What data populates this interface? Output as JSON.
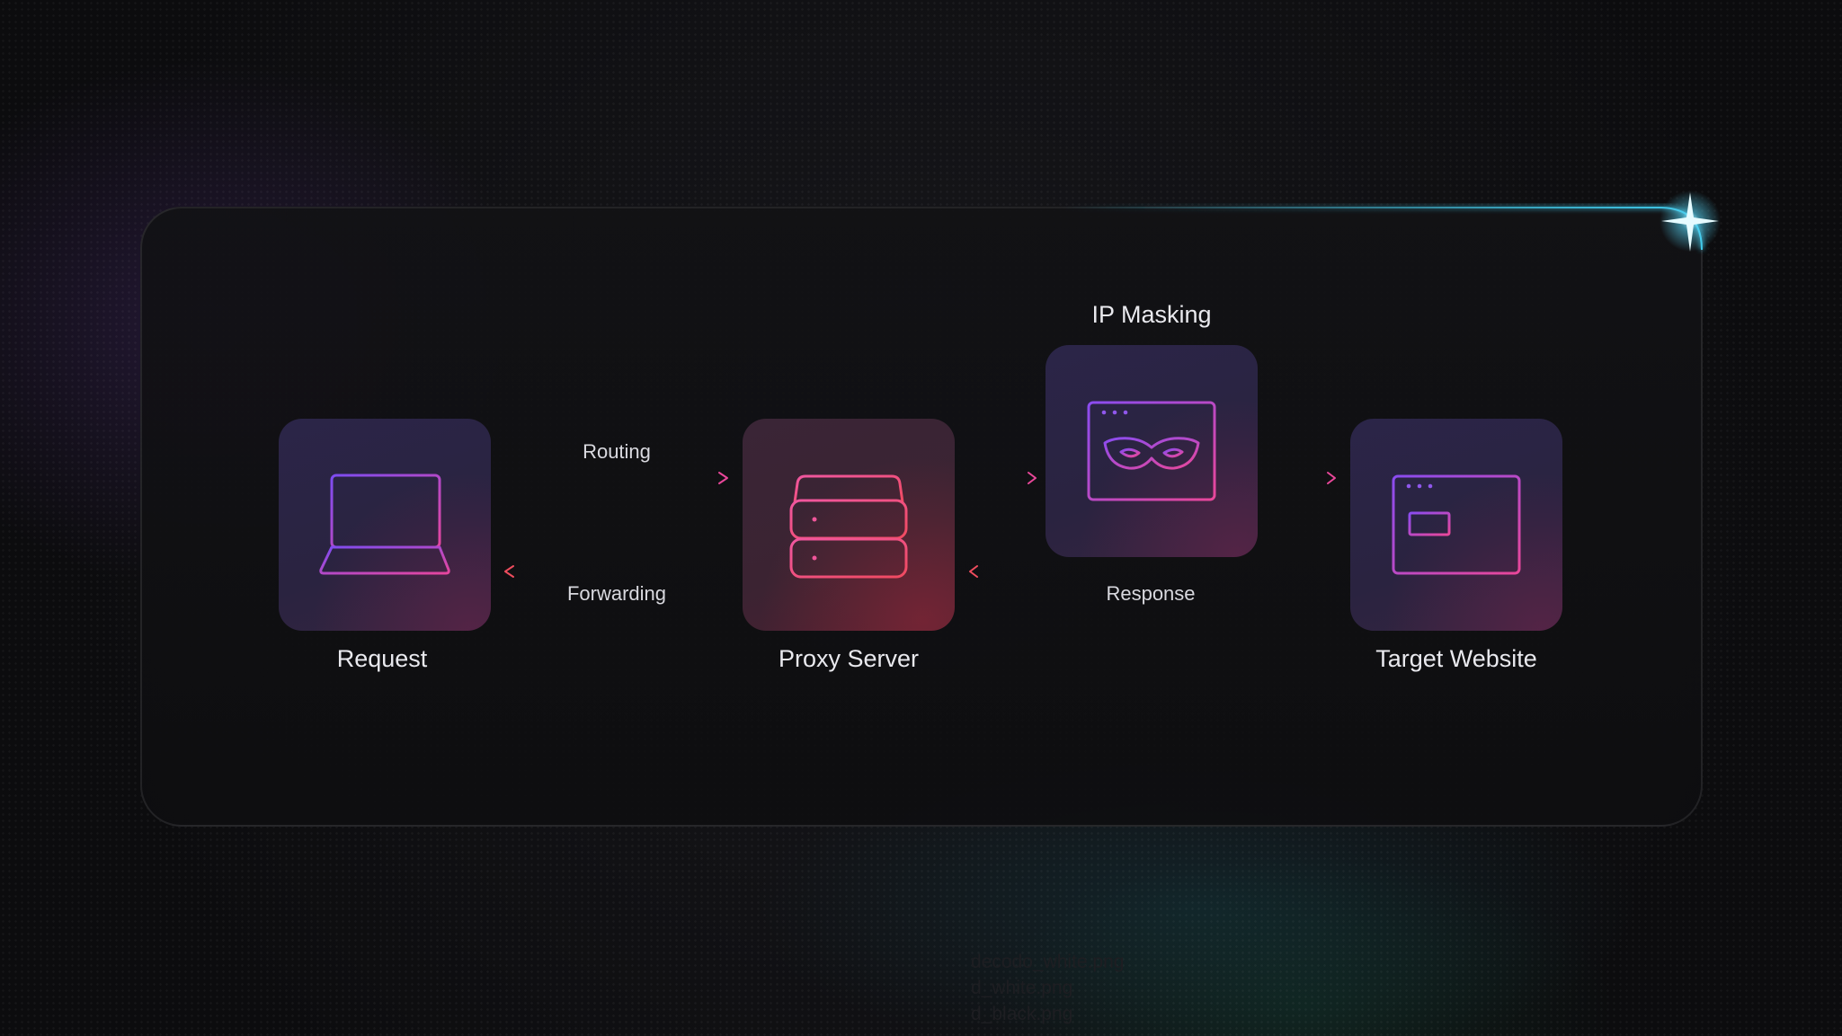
{
  "nodes": {
    "request": "Request",
    "proxy": "Proxy Server",
    "masking": "IP Masking",
    "target": "Target Website"
  },
  "edges": {
    "routing": "Routing",
    "forwarding": "Forwarding",
    "response": "Response"
  },
  "files": [
    "decodo_white.png",
    "d_white.png",
    "d_black.png"
  ],
  "colors": {
    "accent_purple": "#8a4cf0",
    "accent_pink": "#f0458c",
    "accent_red": "#ef4d5e",
    "glow_cyan": "#3fc9ea"
  }
}
